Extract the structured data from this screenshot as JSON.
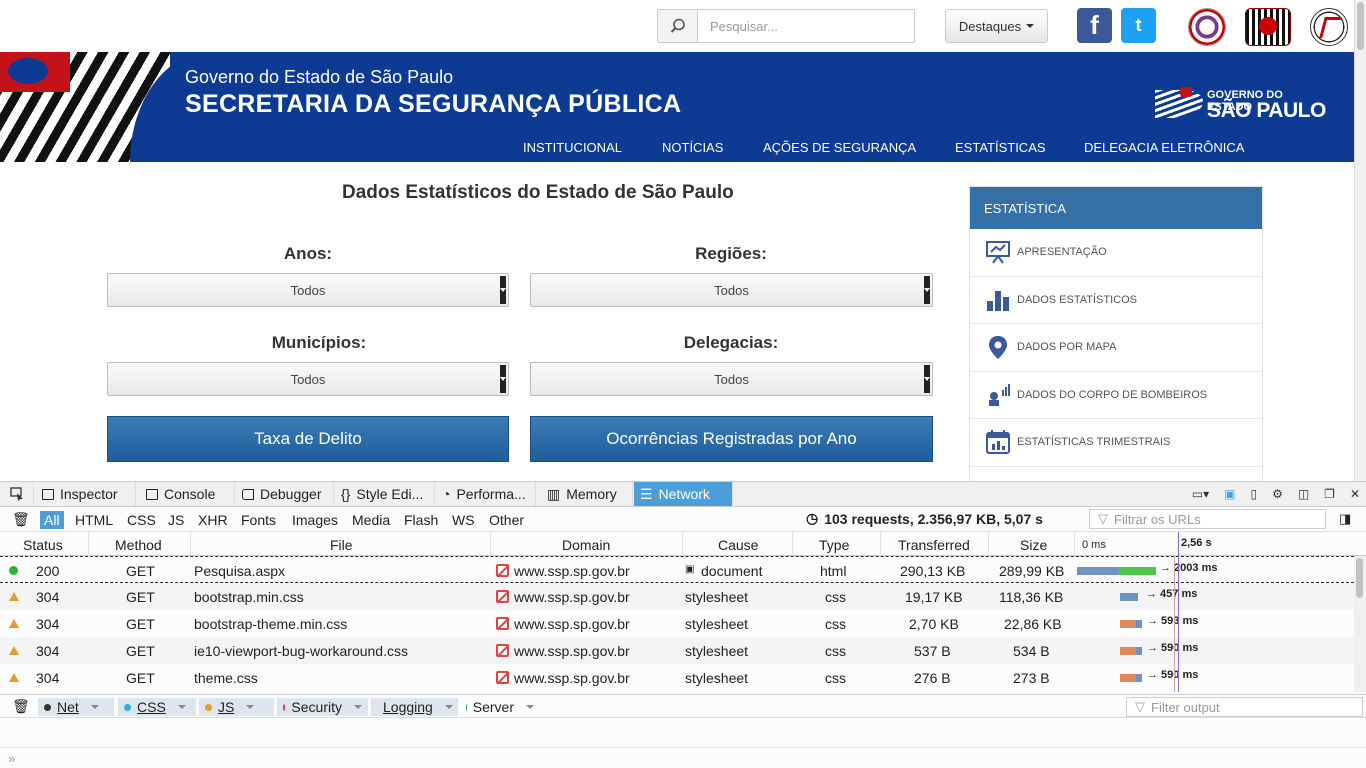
{
  "top": {
    "search_placeholder": "Pesquisar...",
    "destaques": "Destaques",
    "facebook": "f",
    "twitter": "t"
  },
  "header": {
    "gov_line": "Governo do Estado de São Paulo",
    "sec_line": "SECRETARIA DA SEGURANÇA PÚBLICA",
    "logo_small": "GOVERNO DO ESTADO",
    "logo_big": "SÃO PAULO",
    "nav": [
      "INSTITUCIONAL",
      "NOTÍCIAS",
      "AÇÕES DE SEGURANÇA",
      "ESTATÍSTICAS",
      "DELEGACIA ELETRÔNICA"
    ]
  },
  "main": {
    "title": "Dados Estatísticos do Estado de São Paulo",
    "anos_label": "Anos:",
    "anos_value": "Todos",
    "regioes_label": "Regiões:",
    "regioes_value": "Todos",
    "municipios_label": "Municípios:",
    "municipios_value": "Todos",
    "delegacias_label": "Delegacias:",
    "delegacias_value": "Todos",
    "btn_taxa": "Taxa de Delito",
    "btn_ocorrencias": "Ocorrências Registradas por Ano"
  },
  "sidebar": {
    "heading": "ESTATÍSTICA",
    "items": [
      {
        "label": "APRESENTAÇÃO",
        "icon": "presentation-icon"
      },
      {
        "label": "DADOS ESTATÍSTICOS",
        "icon": "bar-chart-icon"
      },
      {
        "label": "DADOS POR MAPA",
        "icon": "map-pin-icon"
      },
      {
        "label": "DADOS DO CORPO DE BOMBEIROS",
        "icon": "firefighter-icon"
      },
      {
        "label": "ESTATÍSTICAS TRIMESTRAIS",
        "icon": "calendar-icon"
      }
    ]
  },
  "devtools": {
    "tabs": [
      "Inspector",
      "Console",
      "Debugger",
      "Style Edi...",
      "Performa...",
      "Memory",
      "Network"
    ],
    "active_tab": "Network",
    "types": [
      "All",
      "HTML",
      "CSS",
      "JS",
      "XHR",
      "Fonts",
      "Images",
      "Media",
      "Flash",
      "WS",
      "Other"
    ],
    "summary": "103 requests, 2.356,97 KB, 5,07 s",
    "url_filter_placeholder": "Filtrar os URLs",
    "columns": [
      "Status",
      "Method",
      "File",
      "Domain",
      "Cause",
      "Type",
      "Transferred",
      "Size"
    ],
    "timeline_start": "0 ms",
    "timeline_marker": "2,56 s",
    "requests": [
      {
        "status": "200",
        "method": "GET",
        "file": "Pesquisa.aspx",
        "domain": "www.ssp.sp.gov.br",
        "cause": "document",
        "type": "html",
        "transferred": "290,13 KB",
        "size": "289,99 KB",
        "time": "→ 2003 ms"
      },
      {
        "status": "304",
        "method": "GET",
        "file": "bootstrap.min.css",
        "domain": "www.ssp.sp.gov.br",
        "cause": "stylesheet",
        "type": "css",
        "transferred": "19,17 KB",
        "size": "118,36 KB",
        "time": "→ 457 ms"
      },
      {
        "status": "304",
        "method": "GET",
        "file": "bootstrap-theme.min.css",
        "domain": "www.ssp.sp.gov.br",
        "cause": "stylesheet",
        "type": "css",
        "transferred": "2,70 KB",
        "size": "22,86 KB",
        "time": "→ 593 ms"
      },
      {
        "status": "304",
        "method": "GET",
        "file": "ie10-viewport-bug-workaround.css",
        "domain": "www.ssp.sp.gov.br",
        "cause": "stylesheet",
        "type": "css",
        "transferred": "537 B",
        "size": "534 B",
        "time": "→ 590 ms"
      },
      {
        "status": "304",
        "method": "GET",
        "file": "theme.css",
        "domain": "www.ssp.sp.gov.br",
        "cause": "stylesheet",
        "type": "css",
        "transferred": "276 B",
        "size": "273 B",
        "time": "→ 590 ms"
      }
    ],
    "console_filters": [
      {
        "label": "Net",
        "color": "#333333"
      },
      {
        "label": "CSS",
        "color": "#2bb0e0"
      },
      {
        "label": "JS",
        "color": "#e69d2b"
      },
      {
        "label": "Security",
        "color": "#e04040"
      },
      {
        "label": "Logging",
        "color": "#999999"
      },
      {
        "label": "Server",
        "color": "#3ba04a"
      }
    ],
    "output_filter_placeholder": "Filter output",
    "prompt": "»"
  },
  "colors": {
    "header_blue": "#0d3b94",
    "sidebar_head": "#3570a6",
    "button_blue": "#2a6ca8",
    "devtools_active": "#4c9ed9"
  }
}
